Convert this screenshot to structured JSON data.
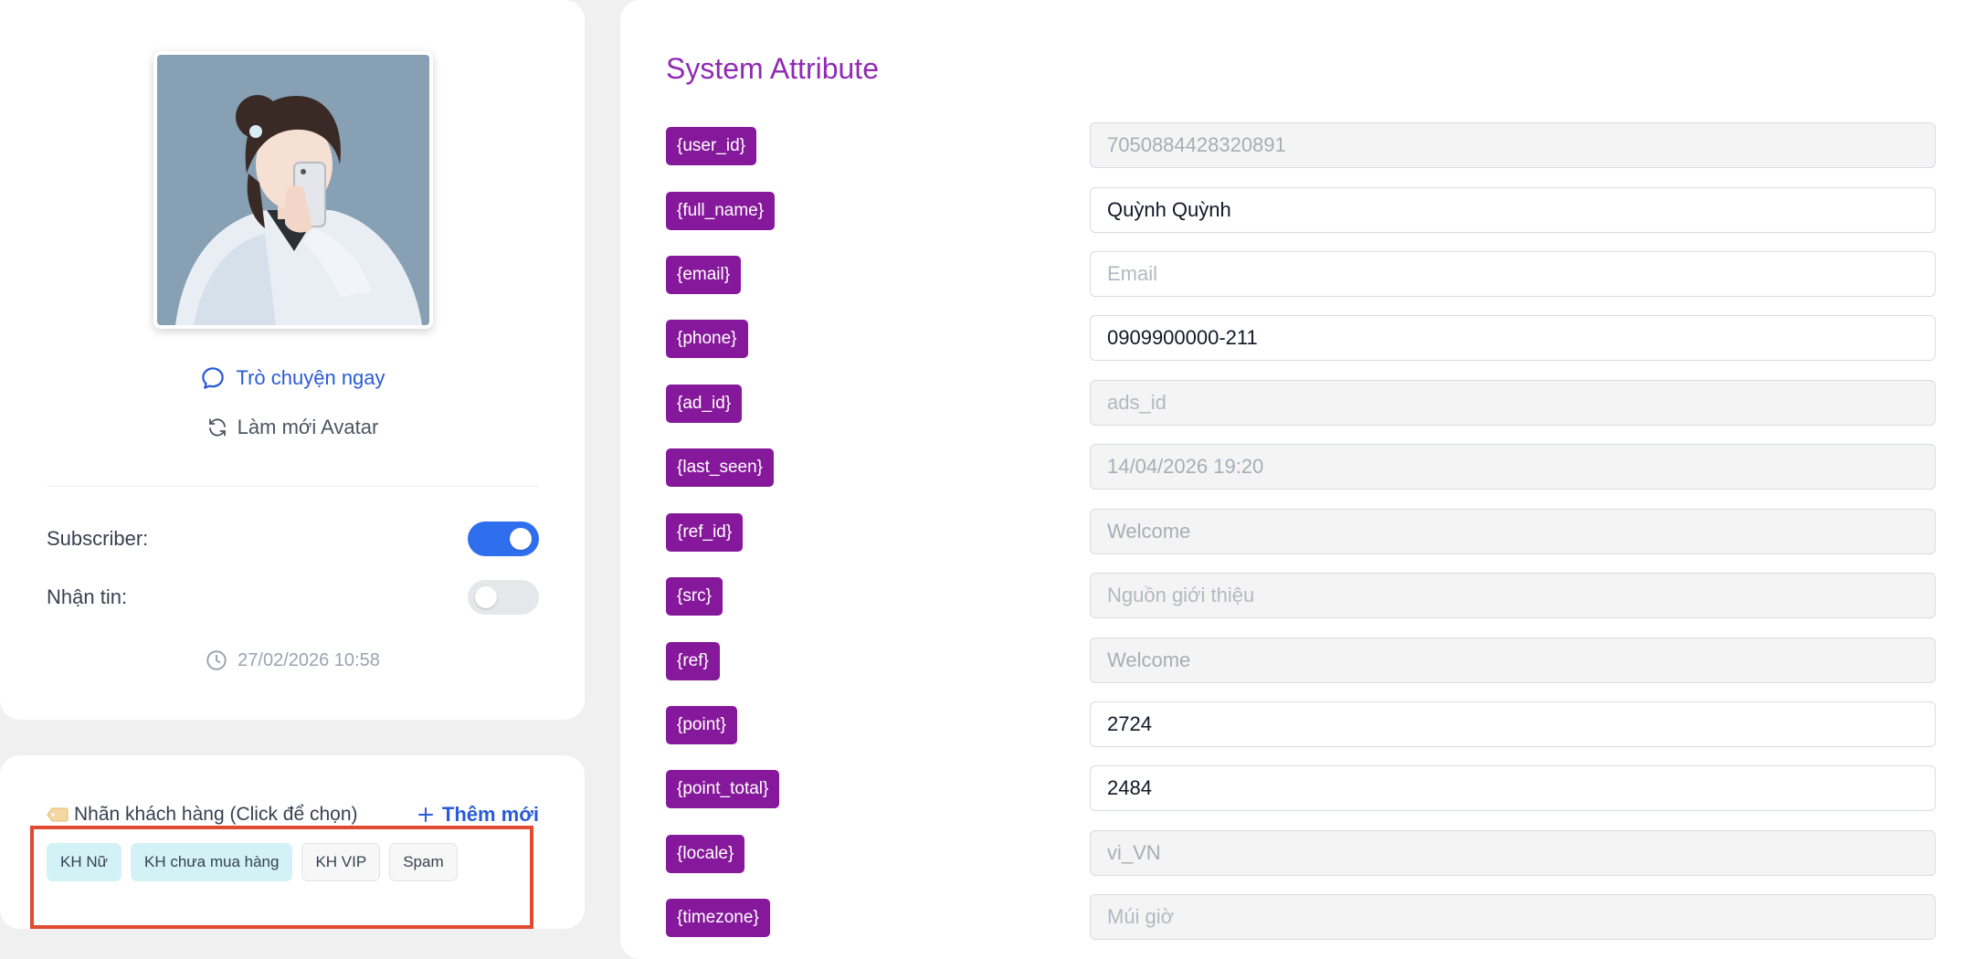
{
  "profile": {
    "chat_label": "Trò chuyện ngay",
    "refresh_label": "Làm mới Avatar",
    "subscriber_label": "Subscriber:",
    "subscriber_on": true,
    "receive_label": "Nhận tin:",
    "receive_on": false,
    "timestamp": "27/02/2026 10:58"
  },
  "labels": {
    "title": "Nhãn khách hàng (Click để chọn)",
    "add_label": "Thêm mới",
    "chips": [
      {
        "text": "KH Nữ",
        "selected": true
      },
      {
        "text": "KH chưa mua hàng",
        "selected": true
      },
      {
        "text": "KH VIP",
        "selected": false
      },
      {
        "text": "Spam",
        "selected": false
      }
    ]
  },
  "attributes": {
    "title": "System Attribute",
    "rows": [
      {
        "tag": "{user_id}",
        "value": "7050884428320891",
        "placeholder": "",
        "disabled": true
      },
      {
        "tag": "{full_name}",
        "value": "Quỳnh Quỳnh",
        "placeholder": "",
        "disabled": false
      },
      {
        "tag": "{email}",
        "value": "",
        "placeholder": "Email",
        "disabled": false
      },
      {
        "tag": "{phone}",
        "value": "0909900000-211",
        "placeholder": "",
        "disabled": false
      },
      {
        "tag": "{ad_id}",
        "value": "",
        "placeholder": "ads_id",
        "disabled": true
      },
      {
        "tag": "{last_seen}",
        "value": "14/04/2026 19:20",
        "placeholder": "",
        "disabled": true
      },
      {
        "tag": "{ref_id}",
        "value": "Welcome",
        "placeholder": "",
        "disabled": true
      },
      {
        "tag": "{src}",
        "value": "",
        "placeholder": "Nguồn giới thiệu",
        "disabled": true
      },
      {
        "tag": "{ref}",
        "value": "Welcome",
        "placeholder": "",
        "disabled": true
      },
      {
        "tag": "{point}",
        "value": "2724",
        "placeholder": "",
        "disabled": false
      },
      {
        "tag": "{point_total}",
        "value": "2484",
        "placeholder": "",
        "disabled": false
      },
      {
        "tag": "{locale}",
        "value": "vi_VN",
        "placeholder": "",
        "disabled": true
      },
      {
        "tag": "{timezone}",
        "value": "",
        "placeholder": "Múi giờ",
        "disabled": true
      }
    ]
  },
  "colors": {
    "accent_purple": "#86199b",
    "title_purple": "#8f2bb3",
    "link_blue": "#2a5bd7",
    "toggle_on": "#2f6fed",
    "highlight_red": "#e04a2f",
    "chip_selected": "#d3f2f6"
  },
  "icons": {
    "chat": "chat-bubble-icon",
    "refresh": "refresh-icon",
    "clock": "clock-icon",
    "tag": "tag-icon",
    "add": "plus-icon"
  }
}
